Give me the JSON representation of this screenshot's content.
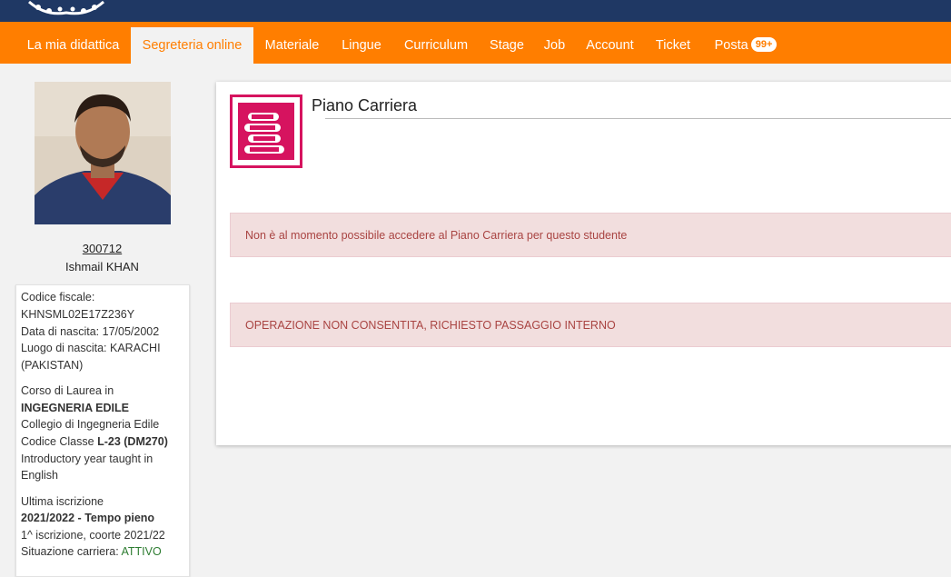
{
  "colors": {
    "brand_orange": "#ff7e00",
    "header_blue": "#1f3864",
    "accent_magenta": "#d6135f",
    "alert_bg": "#f2dede",
    "alert_text": "#a94442"
  },
  "nav": {
    "items": [
      {
        "label": "La mia didattica"
      },
      {
        "label": "Segreteria online"
      },
      {
        "label": "Materiale"
      },
      {
        "label": "Lingue"
      },
      {
        "label": "Curriculum"
      },
      {
        "label": "Stage"
      },
      {
        "label": "Job"
      },
      {
        "label": "Account"
      },
      {
        "label": "Ticket"
      },
      {
        "label": "Posta"
      }
    ],
    "active": "Segreteria online",
    "mail_badge": "99+"
  },
  "student": {
    "id": "300712",
    "name": "Ishmail KHAN",
    "codice_fiscale_label": "Codice fiscale:",
    "codice_fiscale": "KHNSML02E17Z236Y",
    "data_nascita": "Data di nascita: 17/05/2002",
    "luogo_nascita_1": "Luogo di nascita: KARACHI",
    "luogo_nascita_2": "(PAKISTAN)",
    "corso_label": "Corso di Laurea in",
    "corso": "INGEGNERIA EDILE",
    "collegio": "Collegio di Ingegneria Edile",
    "classe_label": "Codice Classe ",
    "classe": "L-23 (DM270)",
    "intro_1": "Introductory year taught in",
    "intro_2": "English",
    "ultima_label": "Ultima iscrizione",
    "ultima": "2021/2022 - Tempo pieno",
    "coorte": "1^ iscrizione, coorte 2021/22",
    "situazione_label": "Situazione carriera: ",
    "situazione": "ATTIVO"
  },
  "main": {
    "title": "Piano Carriera",
    "icon": "books-stack-icon",
    "alerts": [
      "Non è al momento possibile accedere al Piano Carriera per questo studente",
      "OPERAZIONE NON CONSENTITA, RICHIESTO PASSAGGIO INTERNO"
    ]
  }
}
